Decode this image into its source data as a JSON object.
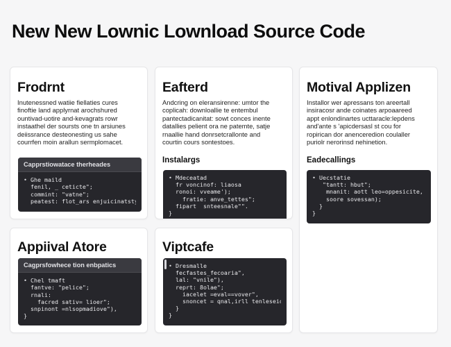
{
  "page": {
    "title": "New New Lownic Lownload Source Code"
  },
  "cards": {
    "frontend": {
      "title": "Frodrnt",
      "description": [
        "Inutenessned watiie fiellaties cures",
        "finoftie land applyrnat arochshured",
        "ountivad-uotire and-kevagrats rowr",
        "instaathel der soursts one tn arsiunes",
        "deiissrance desteonesting us sahe",
        "courrfen moin arallun sermplomacet."
      ],
      "code": {
        "header": "Capprstiowatace therheades",
        "lines": [
          {
            "bullet": "•",
            "text": " Ghe maild"
          },
          {
            "bullet": "",
            "text": "  fenil, _ ceticte\";"
          },
          {
            "bullet": "",
            "text": "  commint: \"vatne\";"
          },
          {
            "bullet": "",
            "text": "  peatest: flot_ars enjuicinatsty."
          }
        ]
      }
    },
    "after": {
      "title": "Eafterd",
      "description": [
        "Andcring on eleransirenne: umtor the",
        "coplicah: downloallie te entembul",
        "pantectadicanitat: sowt conces inente",
        "datallies pelient ora ne patemte, satje",
        "rnaallie hand donrsetcrallonte and",
        "courtin cours sontestoes."
      ],
      "subheading": "Instalargs",
      "code": {
        "lines": [
          {
            "bullet": "•",
            "text": " Mdeceatad"
          },
          {
            "bullet": "",
            "text": "  fr voncinof: liaosa"
          },
          {
            "bullet": "",
            "text": "  ronoi: vveame');"
          },
          {
            "bullet": "",
            "text": "    fratie: anve_tettes\";"
          },
          {
            "bullet": "",
            "text": "  fipart  snteesnale\"\"."
          },
          {
            "bullet": "",
            "text": "}"
          }
        ]
      }
    },
    "motival": {
      "title": "Motival Applizen",
      "description": [
        "Installor wer apressans ton areertall",
        "insiracosr ande coinates arpoaareed",
        "appt enlondinartes ucttaracle:lepdens",
        "and'ante s 'apicdersasl st cou for",
        "ropirican dor anenceredion coulaller",
        "puriolr nerorinsd nehinetion."
      ],
      "subheading": "Eadecallings",
      "code": {
        "lines": [
          {
            "bullet": "•",
            "text": " Uecstatie"
          },
          {
            "bullet": "",
            "text": "   \"tantt: hbut\";"
          },
          {
            "bullet": "",
            "text": "    mnanit: aott leo=oppesicite,"
          },
          {
            "bullet": "",
            "text": "    soore sovessan);"
          },
          {
            "bullet": "",
            "text": "  }"
          },
          {
            "bullet": "",
            "text": "}"
          }
        ]
      }
    },
    "approval": {
      "title": "Appiival Atore",
      "code": {
        "header": "Cagprsfowhece tion enbpatics",
        "lines": [
          {
            "bullet": "•",
            "text": " Chel tmaft"
          },
          {
            "bullet": "",
            "text": "  fantve: \"pelice\";"
          },
          {
            "bullet": "",
            "text": "  rnali:"
          },
          {
            "bullet": "",
            "text": "    facred sativ= lioer\";           {"
          },
          {
            "bullet": "",
            "text": "  snpinont =nlsopmadiove\"),"
          },
          {
            "bullet": "",
            "text": "}"
          }
        ]
      }
    },
    "viptcafe": {
      "title": "Viptcafe",
      "code": {
        "lines": [
          {
            "bullet": "•",
            "text": " Dresmalle"
          },
          {
            "bullet": "",
            "text": "  fecfastes_fecoaria\","
          },
          {
            "bullet": "",
            "text": "  lal: \"vnile\"),"
          },
          {
            "bullet": "",
            "text": "  reprt: 8olae\";"
          },
          {
            "bullet": "",
            "text": "    iacelet =eval==vover\","
          },
          {
            "bullet": "",
            "text": "    snoncet = qnal,irll tenleseior\"("
          },
          {
            "bullet": "",
            "text": "  }"
          },
          {
            "bullet": "",
            "text": "}"
          }
        ]
      }
    }
  }
}
